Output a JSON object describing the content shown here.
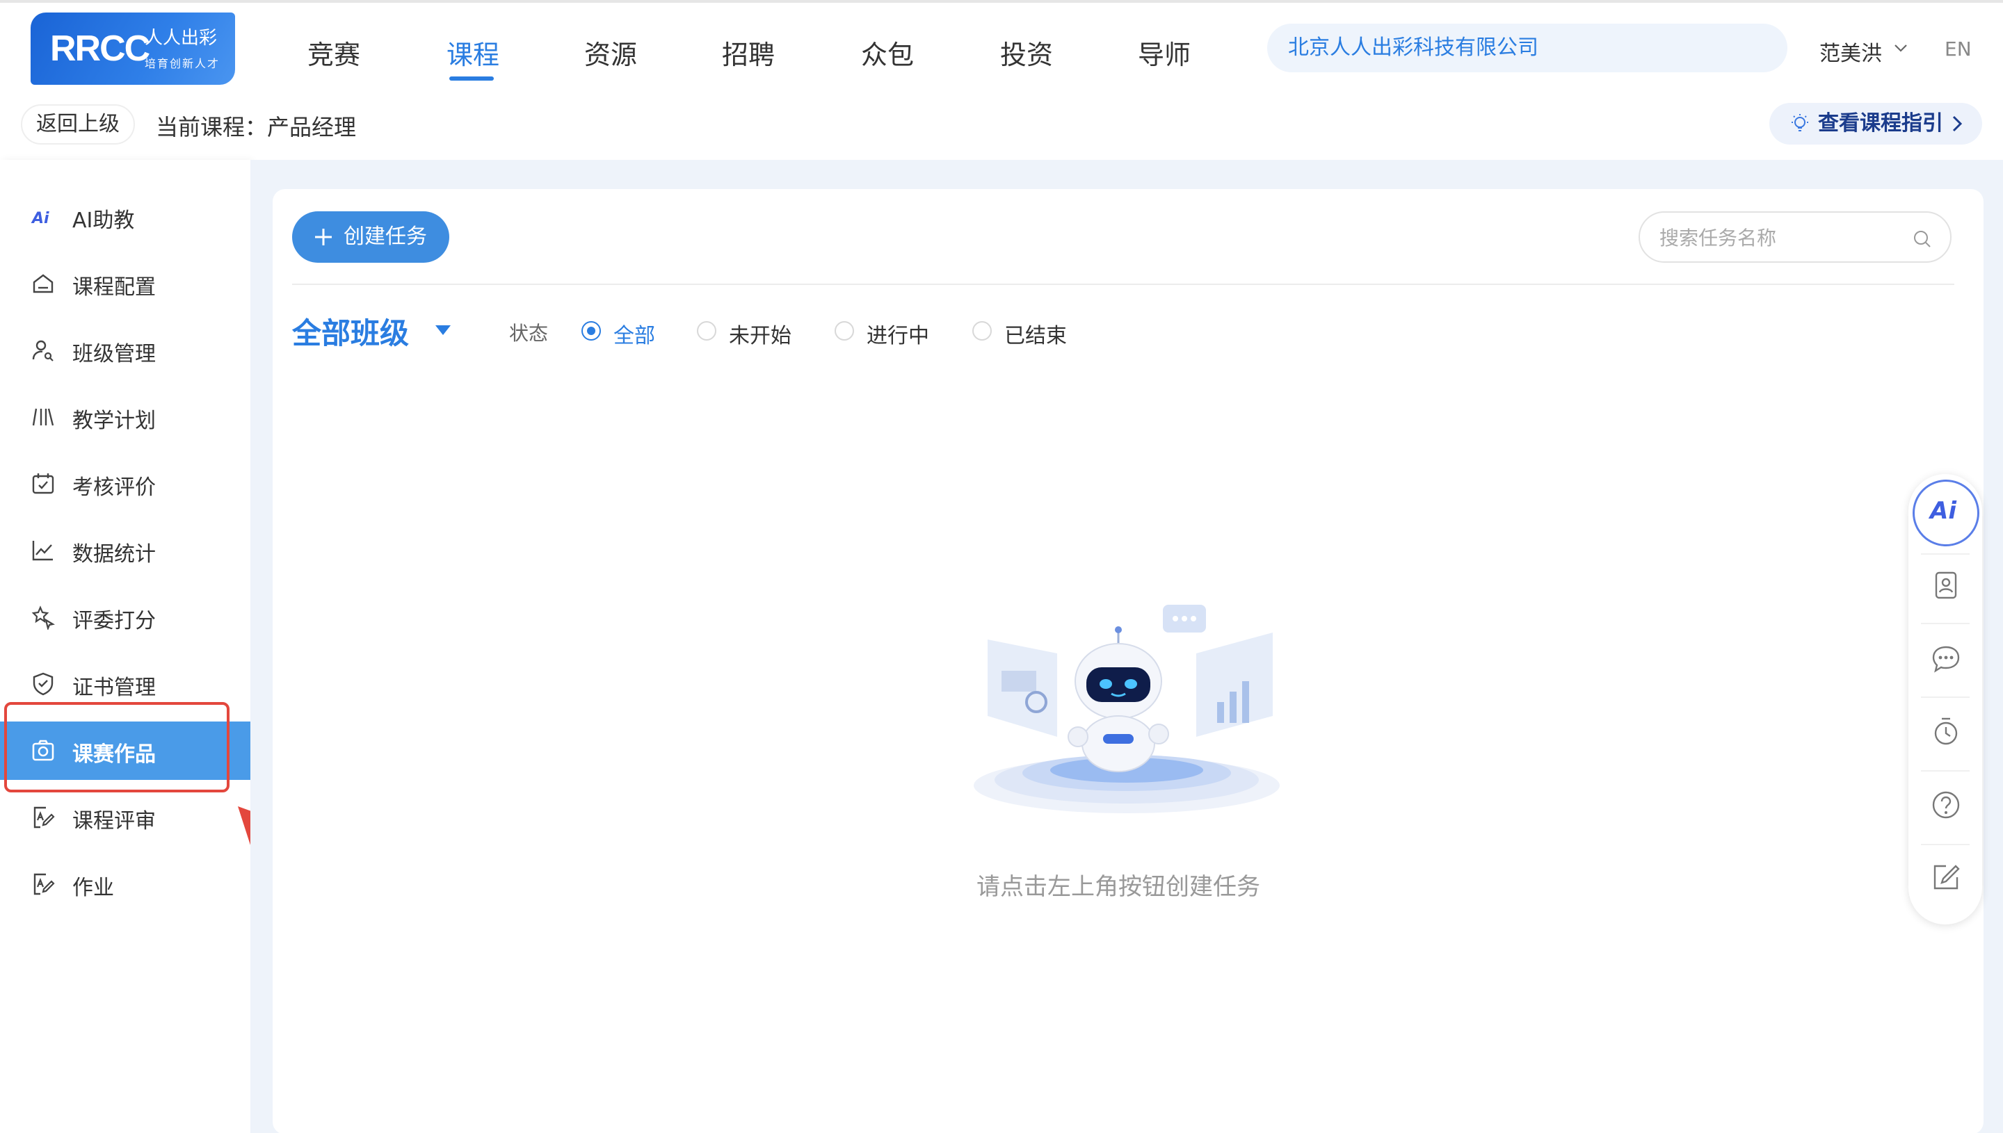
{
  "brand": {
    "mark": "RRCC",
    "name": "人人出彩",
    "tagline": "培育创新人才"
  },
  "nav": {
    "items": [
      {
        "label": "竞赛"
      },
      {
        "label": "课程",
        "active": true
      },
      {
        "label": "资源"
      },
      {
        "label": "招聘"
      },
      {
        "label": "众包"
      },
      {
        "label": "投资"
      },
      {
        "label": "导师"
      }
    ],
    "org": "北京人人出彩科技有限公司",
    "user": "范美洪",
    "lang": "EN"
  },
  "subbar": {
    "back": "返回上级",
    "current_course": "当前课程：产品经理",
    "guide": "查看课程指引"
  },
  "sidebar": {
    "items": [
      {
        "label": "AI助教",
        "icon": "ai-icon"
      },
      {
        "label": "课程配置",
        "icon": "home-icon"
      },
      {
        "label": "班级管理",
        "icon": "user-search-icon"
      },
      {
        "label": "教学计划",
        "icon": "books-icon"
      },
      {
        "label": "考核评价",
        "icon": "calendar-check-icon"
      },
      {
        "label": "数据统计",
        "icon": "line-chart-icon"
      },
      {
        "label": "评委打分",
        "icon": "star-cursor-icon"
      },
      {
        "label": "证书管理",
        "icon": "shield-check-icon"
      },
      {
        "label": "课赛作品",
        "icon": "camera-icon",
        "active": true
      },
      {
        "label": "课程评审",
        "icon": "doc-edit-icon"
      },
      {
        "label": "作业",
        "icon": "doc-edit-icon"
      }
    ]
  },
  "main": {
    "create_btn": "创建任务",
    "search_placeholder": "搜索任务名称",
    "class_select": "全部班级",
    "status_label": "状态",
    "status_options": [
      {
        "label": "全部",
        "checked": true
      },
      {
        "label": "未开始"
      },
      {
        "label": "进行中"
      },
      {
        "label": "已结束"
      }
    ],
    "empty_text": "请点击左上角按钮创建任务"
  },
  "float_bar": {
    "ai_label": "Ai",
    "icons": [
      "contact-card-icon",
      "chat-icon",
      "timer-icon",
      "help-icon",
      "edit-icon"
    ]
  },
  "colors": {
    "primary": "#2a7de1",
    "active_sidebar": "#4a9be8",
    "annotation_red": "#e3473d",
    "main_bg": "#eef3fa"
  }
}
